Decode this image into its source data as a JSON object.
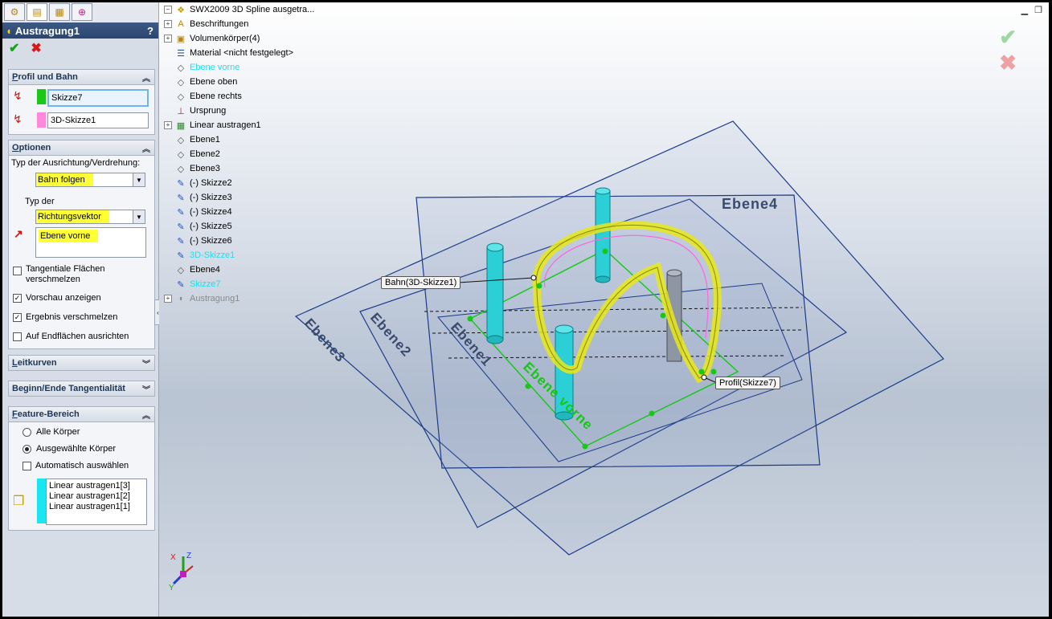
{
  "pm": {
    "tabs": [
      "feature-manager",
      "property-manager",
      "configuration-manager",
      "dimxpert-manager"
    ],
    "title": "Austragung1",
    "help": "?",
    "ok": "✔",
    "cancel": "✖",
    "profil_bahn": {
      "head_u": "P",
      "head_rest": "rofil und Bahn",
      "profile": "Skizze7",
      "path": "3D-Skizze1",
      "profile_color": "#19c819",
      "path_color": "#ff88dd"
    },
    "optionen": {
      "head_u": "O",
      "head_rest": "ptionen",
      "orientation_label": "Typ der Ausrichtung/Verdrehung:",
      "orientation_value": "Bahn folgen",
      "type_label": "Typ der",
      "type_value": "Richtungsvektor",
      "direction_value": "Ebene vorne",
      "tangent_label_1": "Tangentiale Flächen",
      "tangent_label_2": "verschmelzen",
      "preview_label": "Vorschau anzeigen",
      "merge_label": "Ergebnis verschmelzen",
      "align_label": "Auf Endflächen ausrichten"
    },
    "leitkurven": {
      "head_u": "L",
      "head_rest": "eitkurven"
    },
    "tangent_group": {
      "head": "Beginn/Ende Tangentialität"
    },
    "feature_scope": {
      "head_u": "F",
      "head_rest": "eature-Bereich",
      "all_bodies": "Alle Körper",
      "selected_bodies": "Ausgewählte Körper",
      "auto_select": "Automatisch auswählen",
      "bodies": [
        "Linear austragen1[3]",
        "Linear austragen1[2]",
        "Linear austragen1[1]"
      ],
      "bodies_color": "#19e6f0"
    }
  },
  "tree": {
    "root": "SWX2009 3D Spline ausgetra...",
    "items": [
      {
        "label": "Beschriftungen",
        "expand": "+",
        "icon": "annotations-icon"
      },
      {
        "label": "Volumenkörper(4)",
        "expand": "+",
        "icon": "solid-bodies-icon"
      },
      {
        "label": "Material <nicht festgelegt>",
        "expand": "",
        "icon": "material-icon"
      },
      {
        "label": "Ebene vorne",
        "expand": "",
        "icon": "plane-icon",
        "color": "#19e0f0"
      },
      {
        "label": "Ebene oben",
        "expand": "",
        "icon": "plane-icon"
      },
      {
        "label": "Ebene rechts",
        "expand": "",
        "icon": "plane-icon"
      },
      {
        "label": "Ursprung",
        "expand": "",
        "icon": "origin-icon"
      },
      {
        "label": "Linear austragen1",
        "expand": "+",
        "icon": "extrude-icon"
      },
      {
        "label": "Ebene1",
        "expand": "",
        "icon": "plane-icon"
      },
      {
        "label": "Ebene2",
        "expand": "",
        "icon": "plane-icon"
      },
      {
        "label": "Ebene3",
        "expand": "",
        "icon": "plane-icon"
      },
      {
        "label": "(-) Skizze2",
        "expand": "",
        "icon": "sketch-icon"
      },
      {
        "label": "(-) Skizze3",
        "expand": "",
        "icon": "sketch-icon"
      },
      {
        "label": "(-) Skizze4",
        "expand": "",
        "icon": "sketch-icon"
      },
      {
        "label": "(-) Skizze5",
        "expand": "",
        "icon": "sketch-icon"
      },
      {
        "label": "(-) Skizze6",
        "expand": "",
        "icon": "sketch-icon"
      },
      {
        "label": "3D-Skizze1",
        "expand": "",
        "icon": "3d-sketch-icon",
        "color": "#19e0f0"
      },
      {
        "label": "Ebene4",
        "expand": "",
        "icon": "plane-icon"
      },
      {
        "label": "Skizze7",
        "expand": "",
        "icon": "sketch-icon",
        "color": "#19e0f0"
      },
      {
        "label": "Austragung1",
        "expand": "+",
        "icon": "sweep-icon",
        "color": "#8a8a8a"
      }
    ]
  },
  "viewport": {
    "planes": [
      "Ebene4",
      "Ebene3",
      "Ebene2",
      "Ebene1",
      "Ebene vorne"
    ],
    "callout_path": "Bahn(3D-Skizze1)",
    "callout_profile": "Profil(Skizze7)",
    "triad": {
      "x": "X",
      "y": "Y",
      "z": "Z"
    },
    "confirm_ok": "✔",
    "confirm_cancel": "✖"
  }
}
